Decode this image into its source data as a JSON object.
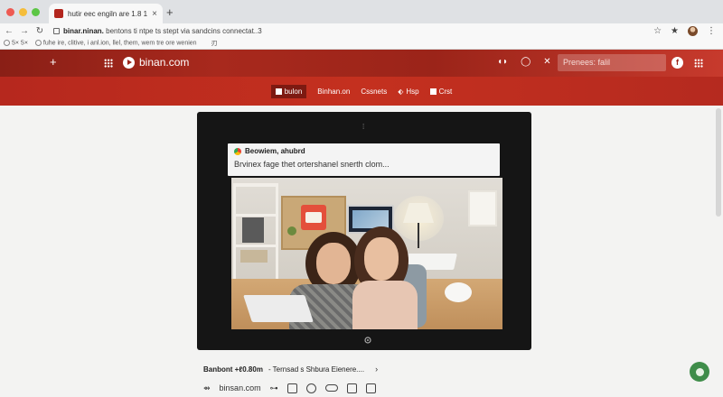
{
  "browser": {
    "tab_title": "hutir eec engiln are 1.8 1 0*",
    "tab_close": "×",
    "new_tab": "+",
    "url_host": "binar.ninan.",
    "url_path": "bentons ti ntpe ts stept via sandcins connectat..3",
    "bookmarks": [
      "5× 5×",
      "fuhe ire, clitive, i anl.ion, llel, them, wem tre ore wenien"
    ],
    "bookmark_tail": "刃"
  },
  "site": {
    "name": "binan.com",
    "plus": "+",
    "search_placeholder": "Prenees: falil",
    "f_badge": "f",
    "close_icon": "✕"
  },
  "subnav": {
    "items": [
      {
        "label": "bulon",
        "active": true
      },
      {
        "label": "Binhan.on"
      },
      {
        "label": "Cssnets"
      },
      {
        "label": "Hsp"
      },
      {
        "label": "Crst"
      }
    ]
  },
  "notification": {
    "title": "Beowiem, ahubrd",
    "body": "Brvinex fage thet ortershanel snerth clom..."
  },
  "caption": {
    "bold": "Banbont +ℓ0.80m",
    "rest": "- Ternsad s Shbura Eienere....",
    "chevron": "›"
  },
  "bottom": {
    "domain": "binsan.com"
  },
  "colors": {
    "brand_red": "#b6281e",
    "brand_dark": "#8a1f16",
    "fab_green": "#3f8d4a"
  }
}
